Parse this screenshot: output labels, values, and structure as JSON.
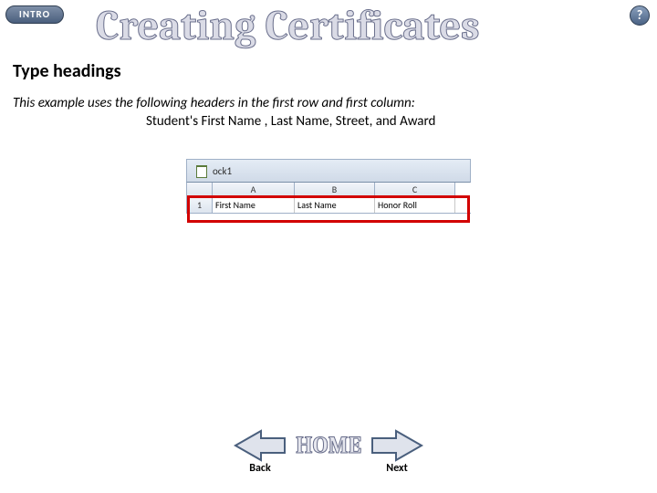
{
  "intro_label": "INTRO",
  "help_label": "?",
  "title": "Creating Certificates",
  "subheading": "Type headings",
  "desc_line1": "This example uses the following headers in the first row and first column:",
  "desc_line2": "Student's First Name , Last Name, Street, and Award",
  "sheet": {
    "doc_name": "ock1",
    "col_a": "A",
    "col_b": "B",
    "col_c": "C",
    "row_1": "1",
    "cell_a1": "First Name",
    "cell_b1": "Last Name",
    "cell_c1": "Honor Roll"
  },
  "nav": {
    "back": "Back",
    "home": "HOME",
    "next": "Next"
  }
}
